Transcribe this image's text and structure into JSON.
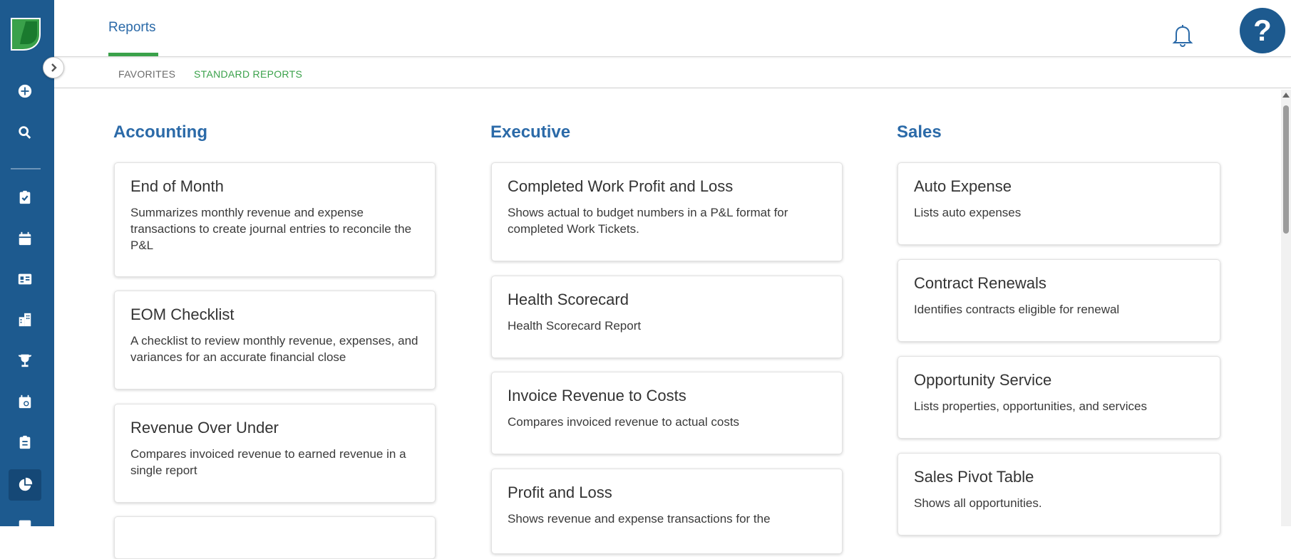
{
  "colors": {
    "sidebar": "#1d5a8f",
    "accent_blue": "#2b6aa8",
    "accent_green": "#3aa14a"
  },
  "header": {
    "tab_label": "Reports",
    "help_label": "?"
  },
  "subtabs": [
    {
      "label": "FAVORITES"
    },
    {
      "label": "STANDARD REPORTS"
    }
  ],
  "sidebar": {
    "items": [
      {
        "icon": "add-circle-icon"
      },
      {
        "icon": "search-icon"
      },
      {
        "icon": "clipboard-check-icon"
      },
      {
        "icon": "calendar-icon"
      },
      {
        "icon": "contact-card-icon"
      },
      {
        "icon": "building-icon"
      },
      {
        "icon": "trophy-icon"
      },
      {
        "icon": "calendar-clock-icon"
      },
      {
        "icon": "clipboard-list-icon"
      },
      {
        "icon": "pie-chart-icon",
        "active": true
      },
      {
        "icon": "id-card-icon"
      }
    ]
  },
  "columns": [
    {
      "title": "Accounting",
      "cards": [
        {
          "title": "End of Month",
          "desc": "Summarizes monthly revenue and expense transactions to create journal entries to reconcile the P&L"
        },
        {
          "title": "EOM Checklist",
          "desc": "A checklist to review monthly revenue, expenses, and variances for an accurate financial close"
        },
        {
          "title": "Revenue Over Under",
          "desc": "Compares invoiced revenue to earned revenue in a single report"
        }
      ]
    },
    {
      "title": "Executive",
      "cards": [
        {
          "title": "Completed Work Profit and Loss",
          "desc": "Shows actual to budget numbers in a P&L format for completed Work Tickets."
        },
        {
          "title": "Health Scorecard",
          "desc": "Health Scorecard Report"
        },
        {
          "title": "Invoice Revenue to Costs",
          "desc": "Compares invoiced revenue to actual costs"
        },
        {
          "title": "Profit and Loss",
          "desc": "Shows revenue and expense transactions for the"
        }
      ]
    },
    {
      "title": "Sales",
      "cards": [
        {
          "title": "Auto Expense",
          "desc": "Lists auto expenses"
        },
        {
          "title": "Contract Renewals",
          "desc": "Identifies contracts eligible for renewal"
        },
        {
          "title": "Opportunity Service",
          "desc": "Lists properties, opportunities, and services"
        },
        {
          "title": "Sales Pivot Table",
          "desc": "Shows all opportunities."
        }
      ]
    }
  ]
}
